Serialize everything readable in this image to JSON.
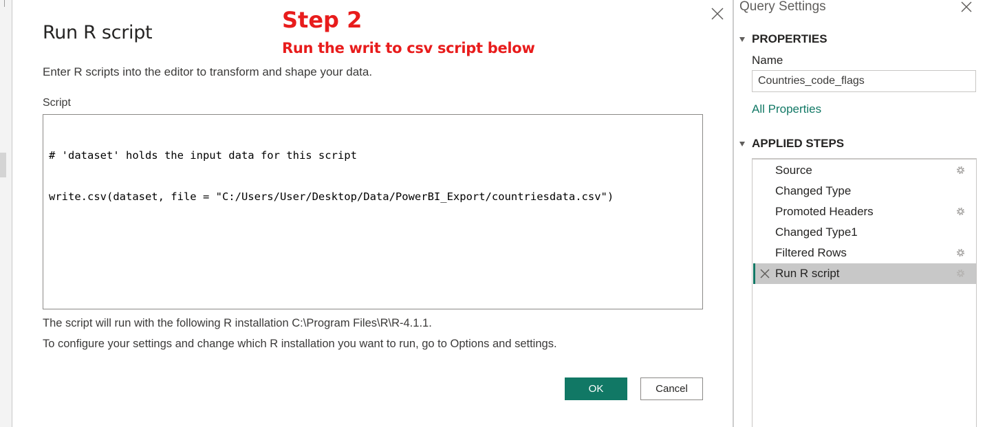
{
  "annotation": {
    "step_title": "Step 2",
    "step_subtitle": "Run the writ to csv script below"
  },
  "dialog": {
    "title": "Run R script",
    "description": "Enter R scripts into the editor to transform and shape your data.",
    "script_label": "Script",
    "script_lines": [
      "# 'dataset' holds the input data for this script",
      "write.csv(dataset, file = \"C:/Users/User/Desktop/Data/PowerBI_Export/countriesdata.csv\")"
    ],
    "info_line_1": "The script will run with the following R installation C:\\Program Files\\R\\R-4.1.1.",
    "info_line_2": "To configure your settings and change which R installation you want to run, go to Options and settings.",
    "ok_label": "OK",
    "cancel_label": "Cancel",
    "close_icon": "close-icon"
  },
  "query_settings": {
    "title": "Query Settings",
    "properties_header": "PROPERTIES",
    "name_label": "Name",
    "name_value": "Countries_code_flags",
    "all_properties": "All Properties",
    "applied_steps_header": "APPLIED STEPS",
    "steps": [
      {
        "label": "Source",
        "has_gear": true,
        "selected": false
      },
      {
        "label": "Changed Type",
        "has_gear": false,
        "selected": false
      },
      {
        "label": "Promoted Headers",
        "has_gear": true,
        "selected": false
      },
      {
        "label": "Changed Type1",
        "has_gear": false,
        "selected": false
      },
      {
        "label": "Filtered Rows",
        "has_gear": true,
        "selected": false
      },
      {
        "label": "Run R script",
        "has_gear": true,
        "selected": true
      }
    ]
  },
  "colors": {
    "accent": "#117865",
    "annotation_red": "#e81c1c",
    "selected_step_bg": "#c8c8c8"
  }
}
